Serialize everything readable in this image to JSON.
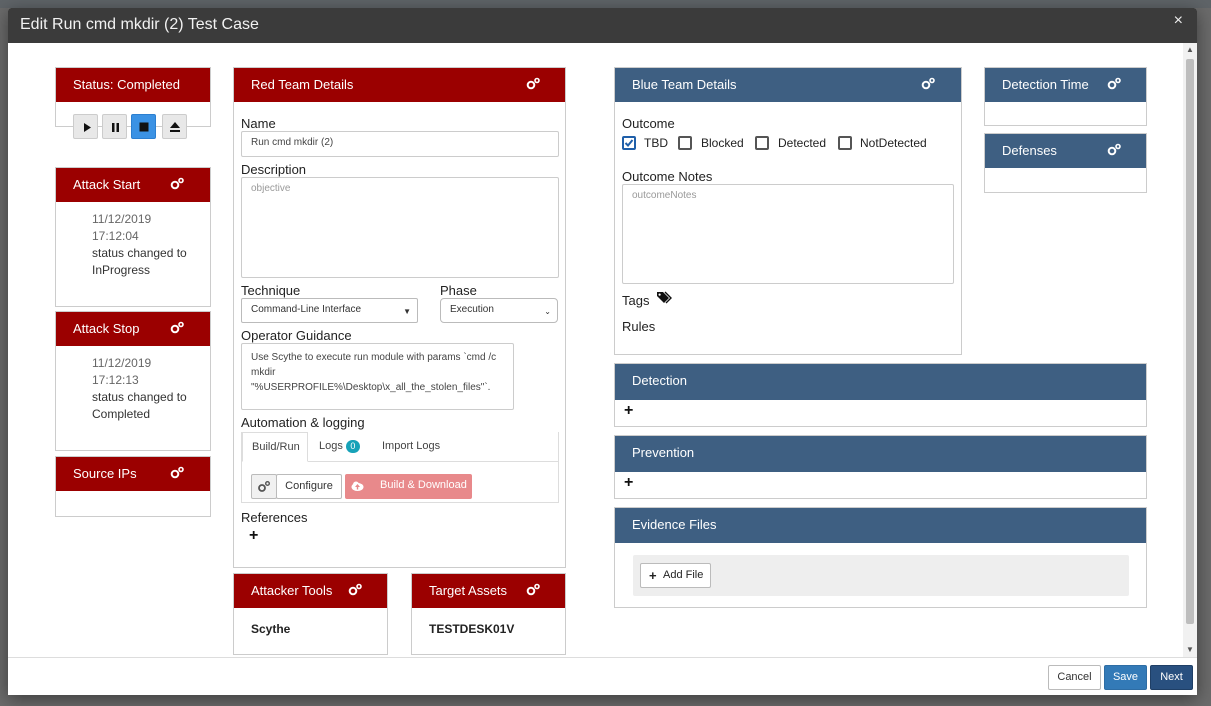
{
  "modal": {
    "title": "Edit Run cmd mkdir (2) Test Case",
    "close_label": "×"
  },
  "status_panel": {
    "title": "Status: Completed"
  },
  "attack_start": {
    "title": "Attack Start",
    "entry": {
      "date": "11/12/2019",
      "time": "17:12:04",
      "text": "status changed to InProgress"
    }
  },
  "attack_stop": {
    "title": "Attack Stop",
    "entry": {
      "date": "11/12/2019",
      "time": "17:12:13",
      "text": "status changed to Completed"
    }
  },
  "source_ips": {
    "title": "Source IPs"
  },
  "red_team": {
    "title": "Red Team Details",
    "name_label": "Name",
    "name_value": "Run cmd mkdir (2)",
    "description_label": "Description",
    "description_placeholder": "objective",
    "technique_label": "Technique",
    "technique_value": "Command-Line Interface",
    "phase_label": "Phase",
    "phase_value": "Execution",
    "guidance_label": "Operator Guidance",
    "guidance_value": "Use Scythe to execute run module with params `cmd /c mkdir \"%USERPROFILE%\\Desktop\\x_all_the_stolen_files\"`.",
    "automation_label": "Automation & logging",
    "tabs": [
      "Build/Run",
      "Logs",
      "Import Logs"
    ],
    "logs_count": "0",
    "configure_label": "Configure",
    "build_label": "Build & Download",
    "references_label": "References"
  },
  "attacker_tools": {
    "title": "Attacker Tools",
    "value": "Scythe"
  },
  "target_assets": {
    "title": "Target Assets",
    "value": "TESTDESK01V"
  },
  "blue_team": {
    "title": "Blue Team Details",
    "outcome_label": "Outcome",
    "outcomes": [
      {
        "label": "TBD",
        "checked": true
      },
      {
        "label": "Blocked",
        "checked": false
      },
      {
        "label": "Detected",
        "checked": false
      },
      {
        "label": "NotDetected",
        "checked": false
      }
    ],
    "notes_label": "Outcome Notes",
    "notes_placeholder": "outcomeNotes",
    "tags_label": "Tags",
    "rules_label": "Rules"
  },
  "detection_time": {
    "title": "Detection Time"
  },
  "defenses": {
    "title": "Defenses"
  },
  "detection": {
    "title": "Detection"
  },
  "prevention": {
    "title": "Prevention"
  },
  "evidence": {
    "title": "Evidence Files",
    "add_label": "Add File"
  },
  "footer": {
    "cancel": "Cancel",
    "save": "Save",
    "next": "Next"
  },
  "colors": {
    "red_header": "#9b0000",
    "blue_header": "#3e5f82",
    "primary": "#337ab7",
    "next": "#29507f"
  },
  "icons": [
    "gears-icon",
    "play-icon",
    "pause-icon",
    "stop-icon",
    "eject-icon",
    "tags-icon",
    "plus-icon",
    "cloud-upload-icon",
    "close-icon"
  ]
}
